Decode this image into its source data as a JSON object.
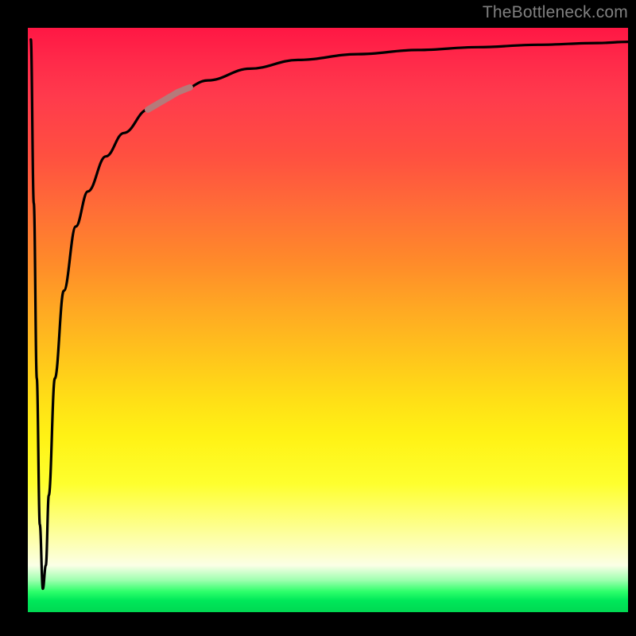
{
  "watermark": "TheBottleneck.com",
  "chart_data": {
    "type": "line",
    "title": "",
    "xlabel": "",
    "ylabel": "",
    "xlim": [
      0,
      100
    ],
    "ylim": [
      0,
      100
    ],
    "grid": false,
    "legend": false,
    "series": [
      {
        "name": "bottleneck-curve",
        "color": "#000000",
        "x": [
          0.5,
          1.0,
          1.5,
          2.0,
          2.5,
          3.0,
          3.5,
          4.5,
          6,
          8,
          10,
          13,
          16,
          20,
          25,
          30,
          37,
          45,
          55,
          65,
          75,
          85,
          95,
          100
        ],
        "values": [
          98,
          70,
          40,
          15,
          4,
          8,
          20,
          40,
          55,
          66,
          72,
          78,
          82,
          86,
          89,
          91,
          93,
          94.5,
          95.5,
          96.2,
          96.7,
          97.1,
          97.4,
          97.6
        ]
      }
    ],
    "highlight": {
      "xrange": [
        20,
        27
      ],
      "color": "#b57a7a",
      "width": 8
    }
  },
  "colors": {
    "background": "#000000",
    "gradient_top": "#ff1744",
    "gradient_mid": "#ffe016",
    "gradient_bottom": "#00d852",
    "curve": "#000000",
    "highlight": "#b57a7a",
    "watermark": "#808080"
  }
}
